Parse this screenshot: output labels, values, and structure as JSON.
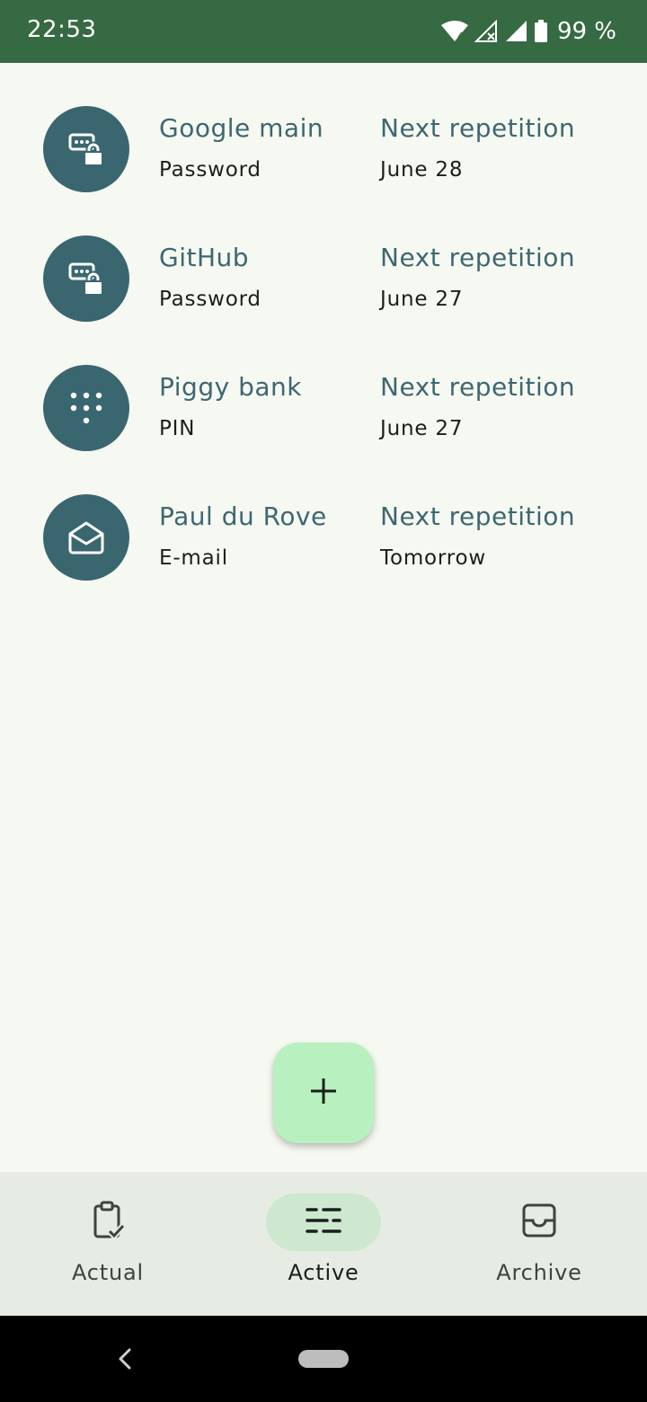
{
  "status_bar": {
    "time": "22:53",
    "wifi_badge": "4",
    "battery_percent": "99 %",
    "icons": [
      "wifi-icon",
      "no-data-signal-icon",
      "cell-signal-icon",
      "battery-icon"
    ]
  },
  "items": [
    {
      "name": "Google main",
      "type": "Password",
      "next_label": "Next repetition",
      "next_date": "June 28",
      "icon": "password-lock-icon"
    },
    {
      "name": "GitHub",
      "type": "Password",
      "next_label": "Next repetition",
      "next_date": "June 27",
      "icon": "password-lock-icon"
    },
    {
      "name": "Piggy bank",
      "type": "PIN",
      "next_label": "Next repetition",
      "next_date": "June 27",
      "icon": "pin-dialpad-icon"
    },
    {
      "name": "Paul du Rove",
      "type": "E-mail",
      "next_label": "Next repetition",
      "next_date": "Tomorrow",
      "icon": "email-envelope-icon"
    }
  ],
  "fab": {
    "icon": "plus-icon"
  },
  "bottom_nav": {
    "items": [
      {
        "label": "Actual",
        "icon": "clipboard-check-icon",
        "active": false
      },
      {
        "label": "Active",
        "icon": "list-sliders-icon",
        "active": true
      },
      {
        "label": "Archive",
        "icon": "inbox-tray-icon",
        "active": false
      }
    ]
  },
  "colors": {
    "status_bar": "#366A42",
    "background": "#F6F9F2",
    "avatar": "#3A6670",
    "accent_text": "#3E6770",
    "fab": "#B8F1BF",
    "nav_bg": "#E6ECE3",
    "nav_active_pill": "#CDE8CF"
  }
}
